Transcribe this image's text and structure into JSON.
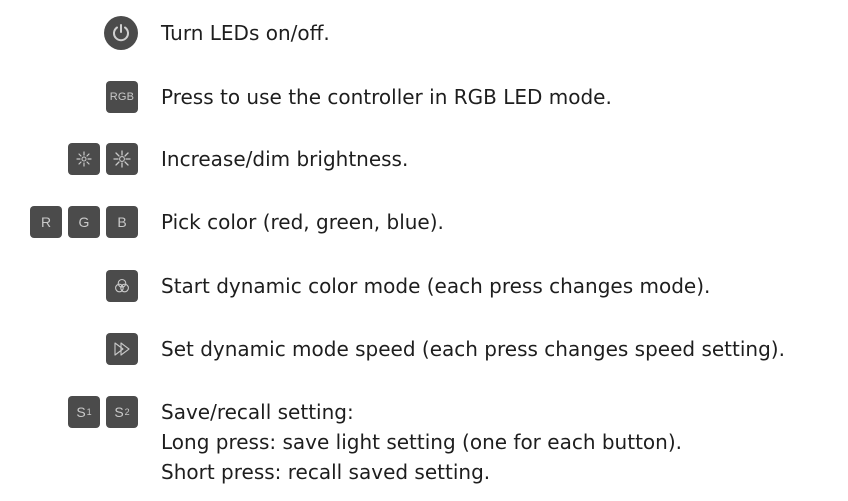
{
  "rows": [
    {
      "id": "power",
      "description": "Turn LEDs on/off."
    },
    {
      "id": "rgb",
      "button_label": "RGB",
      "description": "Press to use the controller in RGB LED mode."
    },
    {
      "id": "brightness",
      "description": "Increase/dim brightness."
    },
    {
      "id": "color",
      "buttons": [
        "R",
        "G",
        "B"
      ],
      "description": "Pick color (red, green, blue)."
    },
    {
      "id": "dynamic",
      "description": "Start dynamic color mode (each press changes mode)."
    },
    {
      "id": "speed",
      "description": "Set dynamic mode speed (each press changes speed setting)."
    },
    {
      "id": "save",
      "buttons": [
        {
          "letter": "S",
          "sub": "1"
        },
        {
          "letter": "S",
          "sub": "2"
        }
      ],
      "description_lines": [
        "Save/recall setting:",
        "Long press: save light setting (one for each button).",
        "Short press: recall saved setting."
      ]
    }
  ],
  "icons": {
    "power": "power-icon",
    "brightness_up": "sun-bright-icon",
    "brightness_down": "sun-dim-icon",
    "dynamic": "color-circles-icon",
    "speed": "fast-forward-icon"
  },
  "colors": {
    "button_bg": "#4b4b4b",
    "button_text": "#c9c9c9",
    "text": "#1e1e1e"
  }
}
